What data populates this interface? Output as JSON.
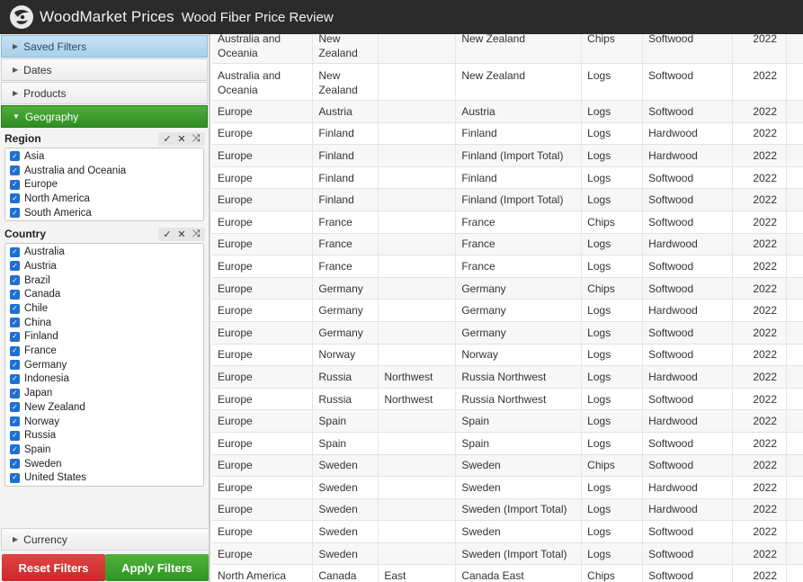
{
  "header": {
    "brand": "WoodMarket Prices",
    "title": "Wood Fiber Price Review",
    "logo_icon": "globe-logo-icon"
  },
  "sidebar": {
    "sections": {
      "saved_filters": "Saved Filters",
      "dates": "Dates",
      "products": "Products",
      "geography": "Geography",
      "currency": "Currency"
    },
    "region": {
      "title": "Region",
      "tools": [
        "✓",
        "✕",
        "⤨"
      ],
      "items": [
        "Asia",
        "Australia and Oceania",
        "Europe",
        "North America",
        "South America"
      ]
    },
    "country": {
      "title": "Country",
      "tools": [
        "✓",
        "✕",
        "⤨"
      ],
      "items": [
        "Australia",
        "Austria",
        "Brazil",
        "Canada",
        "Chile",
        "China",
        "Finland",
        "France",
        "Germany",
        "Indonesia",
        "Japan",
        "New Zealand",
        "Norway",
        "Russia",
        "Spain",
        "Sweden",
        "United States"
      ]
    },
    "buttons": {
      "reset": "Reset Filters",
      "apply": "Apply Filters"
    }
  },
  "table": {
    "rows": [
      [
        "Australia and Oceania",
        "New Zealand",
        "",
        "New Zealand",
        "Chips",
        "Softwood",
        "2022"
      ],
      [
        "Australia and Oceania",
        "New Zealand",
        "",
        "New Zealand",
        "Logs",
        "Softwood",
        "2022"
      ],
      [
        "Europe",
        "Austria",
        "",
        "Austria",
        "Logs",
        "Softwood",
        "2022"
      ],
      [
        "Europe",
        "Finland",
        "",
        "Finland",
        "Logs",
        "Hardwood",
        "2022"
      ],
      [
        "Europe",
        "Finland",
        "",
        "Finland (Import Total)",
        "Logs",
        "Hardwood",
        "2022"
      ],
      [
        "Europe",
        "Finland",
        "",
        "Finland",
        "Logs",
        "Softwood",
        "2022"
      ],
      [
        "Europe",
        "Finland",
        "",
        "Finland (Import Total)",
        "Logs",
        "Softwood",
        "2022"
      ],
      [
        "Europe",
        "France",
        "",
        "France",
        "Chips",
        "Softwood",
        "2022"
      ],
      [
        "Europe",
        "France",
        "",
        "France",
        "Logs",
        "Hardwood",
        "2022"
      ],
      [
        "Europe",
        "France",
        "",
        "France",
        "Logs",
        "Softwood",
        "2022"
      ],
      [
        "Europe",
        "Germany",
        "",
        "Germany",
        "Chips",
        "Softwood",
        "2022"
      ],
      [
        "Europe",
        "Germany",
        "",
        "Germany",
        "Logs",
        "Hardwood",
        "2022"
      ],
      [
        "Europe",
        "Germany",
        "",
        "Germany",
        "Logs",
        "Softwood",
        "2022"
      ],
      [
        "Europe",
        "Norway",
        "",
        "Norway",
        "Logs",
        "Softwood",
        "2022"
      ],
      [
        "Europe",
        "Russia",
        "Northwest",
        "Russia Northwest",
        "Logs",
        "Hardwood",
        "2022"
      ],
      [
        "Europe",
        "Russia",
        "Northwest",
        "Russia Northwest",
        "Logs",
        "Softwood",
        "2022"
      ],
      [
        "Europe",
        "Spain",
        "",
        "Spain",
        "Logs",
        "Hardwood",
        "2022"
      ],
      [
        "Europe",
        "Spain",
        "",
        "Spain",
        "Logs",
        "Softwood",
        "2022"
      ],
      [
        "Europe",
        "Sweden",
        "",
        "Sweden",
        "Chips",
        "Softwood",
        "2022"
      ],
      [
        "Europe",
        "Sweden",
        "",
        "Sweden",
        "Logs",
        "Hardwood",
        "2022"
      ],
      [
        "Europe",
        "Sweden",
        "",
        "Sweden (Import Total)",
        "Logs",
        "Hardwood",
        "2022"
      ],
      [
        "Europe",
        "Sweden",
        "",
        "Sweden",
        "Logs",
        "Softwood",
        "2022"
      ],
      [
        "Europe",
        "Sweden",
        "",
        "Sweden (Import Total)",
        "Logs",
        "Softwood",
        "2022"
      ],
      [
        "North America",
        "Canada",
        "East",
        "Canada East",
        "Chips",
        "Softwood",
        "2022"
      ]
    ]
  },
  "colors": {
    "header_bg": "#2b2b2b",
    "geo_active": "#3a9a2c",
    "saved_filters_bg": "#b5d6ec",
    "reset_btn": "#d43535",
    "apply_btn": "#3ea42f",
    "checkbox": "#1f6fd1"
  }
}
